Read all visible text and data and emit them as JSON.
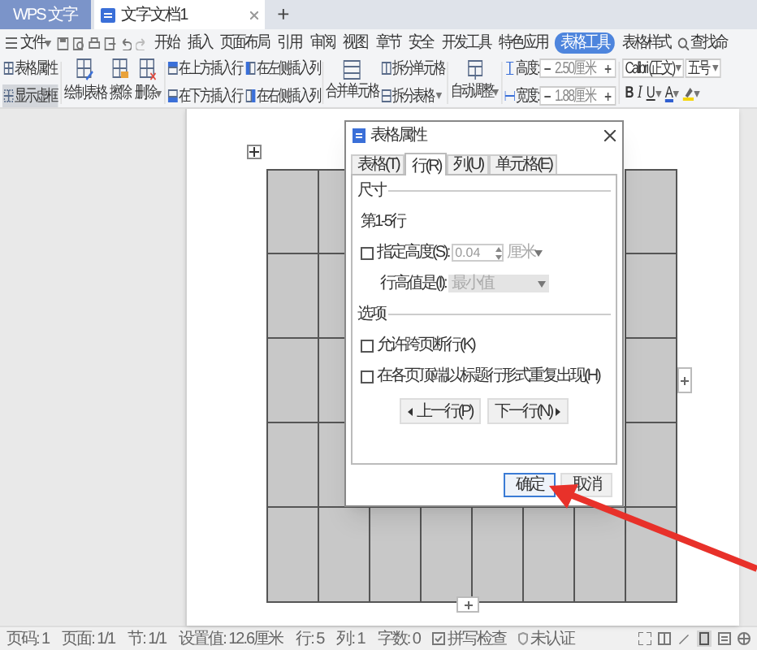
{
  "app_tabs": [
    {
      "label": "WPS 文字",
      "kind": "app",
      "selected": false
    },
    {
      "label": "文字文档1",
      "kind": "doc",
      "selected": true
    }
  ],
  "new_tab": "+",
  "menu": {
    "file": "文件",
    "items": [
      {
        "label": "开始",
        "selected": false
      },
      {
        "label": "插入",
        "selected": false
      },
      {
        "label": "页面布局",
        "selected": false
      },
      {
        "label": "引用",
        "selected": false
      },
      {
        "label": "审阅",
        "selected": false
      },
      {
        "label": "视图",
        "selected": false
      },
      {
        "label": "章节",
        "selected": false
      },
      {
        "label": "安全",
        "selected": false
      },
      {
        "label": "开发工具",
        "selected": false
      },
      {
        "label": "特色应用",
        "selected": false
      },
      {
        "label": "表格工具",
        "selected": true
      },
      {
        "label": "表格样式",
        "selected": false
      }
    ],
    "search": "查找命"
  },
  "ribbon": {
    "toggles": [
      {
        "label": "表格属性",
        "selected": false
      },
      {
        "label": "显示虚框",
        "selected": true
      }
    ],
    "big_tools": [
      {
        "label": "绘制表格",
        "kind": "draw",
        "dropdown": false
      },
      {
        "label": "擦除",
        "kind": "erase",
        "dropdown": false
      },
      {
        "label": "删除",
        "kind": "delete",
        "dropdown": true
      }
    ],
    "insert_rows": [
      "在上方插入行",
      "在下方插入行"
    ],
    "insert_cols": [
      "在左侧插入列",
      "在右侧插入列"
    ],
    "merge": "合并单元格",
    "split": [
      {
        "label": "拆分单元格",
        "dropdown": false
      },
      {
        "label": "拆分表格",
        "dropdown": true
      }
    ],
    "autofit": "自动调整",
    "size_fields": [
      {
        "label": "高度:",
        "value": "2.50厘米"
      },
      {
        "label": "宽度:",
        "value": "1.88厘米"
      }
    ],
    "font": {
      "name": "Calibri (正文)",
      "size": "五号"
    },
    "format_buttons": [
      {
        "kind": "bold",
        "label": "B",
        "dropdown": false
      },
      {
        "kind": "italic",
        "label": "I",
        "dropdown": false
      },
      {
        "kind": "underline",
        "label": "U",
        "dropdown": true
      },
      {
        "kind": "font_color",
        "label": "A",
        "dropdown": true
      },
      {
        "kind": "highlight",
        "dropdown": true
      }
    ]
  },
  "dialog": {
    "title": "表格属性",
    "tabs": [
      {
        "label": "表格(T)",
        "selected": false
      },
      {
        "label": "行(R)",
        "selected": true
      },
      {
        "label": "列(U)",
        "selected": false
      },
      {
        "label": "单元格(E)",
        "selected": false
      }
    ],
    "size_section": "尺寸",
    "rows_label": "第1-5行",
    "height": {
      "label": "指定高度(S):",
      "checked": false,
      "value": "0.04",
      "unit": "厘米"
    },
    "row_height": {
      "label": "行高值是(I):",
      "value": "最小值"
    },
    "options_section": "选项",
    "options": [
      {
        "label": "允许跨页断行(K)",
        "checked": false
      },
      {
        "label": "在各页顶端以标题行形式重复出现(H)",
        "checked": false
      }
    ],
    "nav_buttons": [
      {
        "label": "上一行(P)",
        "kind": "prev"
      },
      {
        "label": "下一行(N)",
        "kind": "next"
      }
    ],
    "ok": "确定",
    "cancel": "取消"
  },
  "status_bar": {
    "items": [
      "页码: 1",
      "页面: 1/1",
      "节: 1/1",
      "设置值: 12.6厘米",
      "行: 5",
      "列: 1",
      "字数: 0"
    ],
    "spell_check": "拼写检查",
    "certification": "未认证"
  }
}
